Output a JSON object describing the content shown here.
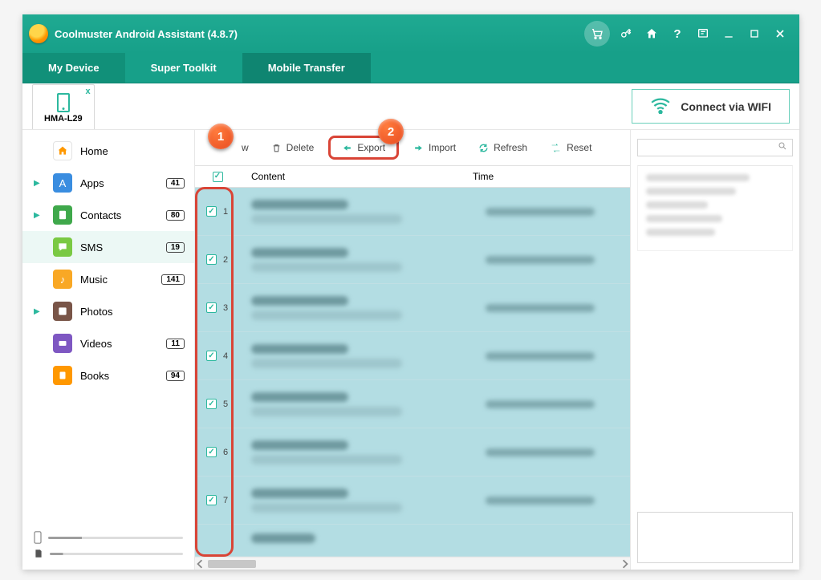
{
  "title": "Coolmuster Android Assistant (4.8.7)",
  "tabs": {
    "mydevice": "My Device",
    "supertoolkit": "Super Toolkit",
    "mobiletransfer": "Mobile Transfer"
  },
  "device": {
    "name": "HMA-L29"
  },
  "connect_wifi": "Connect via WIFI",
  "sidebar": {
    "items": [
      {
        "label": "Home",
        "badge": "",
        "expandable": false
      },
      {
        "label": "Apps",
        "badge": "41",
        "expandable": true
      },
      {
        "label": "Contacts",
        "badge": "80",
        "expandable": true
      },
      {
        "label": "SMS",
        "badge": "19",
        "expandable": false
      },
      {
        "label": "Music",
        "badge": "141",
        "expandable": false
      },
      {
        "label": "Photos",
        "badge": "",
        "expandable": true
      },
      {
        "label": "Videos",
        "badge": "11",
        "expandable": false
      },
      {
        "label": "Books",
        "badge": "94",
        "expandable": false
      }
    ]
  },
  "toolbar": {
    "new": "w",
    "delete": "Delete",
    "export": "Export",
    "import": "Import",
    "refresh": "Refresh",
    "reset": "Reset"
  },
  "columns": {
    "content": "Content",
    "time": "Time"
  },
  "rows": [
    {
      "n": "1"
    },
    {
      "n": "2"
    },
    {
      "n": "3"
    },
    {
      "n": "4"
    },
    {
      "n": "5"
    },
    {
      "n": "6"
    },
    {
      "n": "7"
    }
  ],
  "search": {
    "placeholder": ""
  },
  "callouts": {
    "one": "1",
    "two": "2"
  }
}
